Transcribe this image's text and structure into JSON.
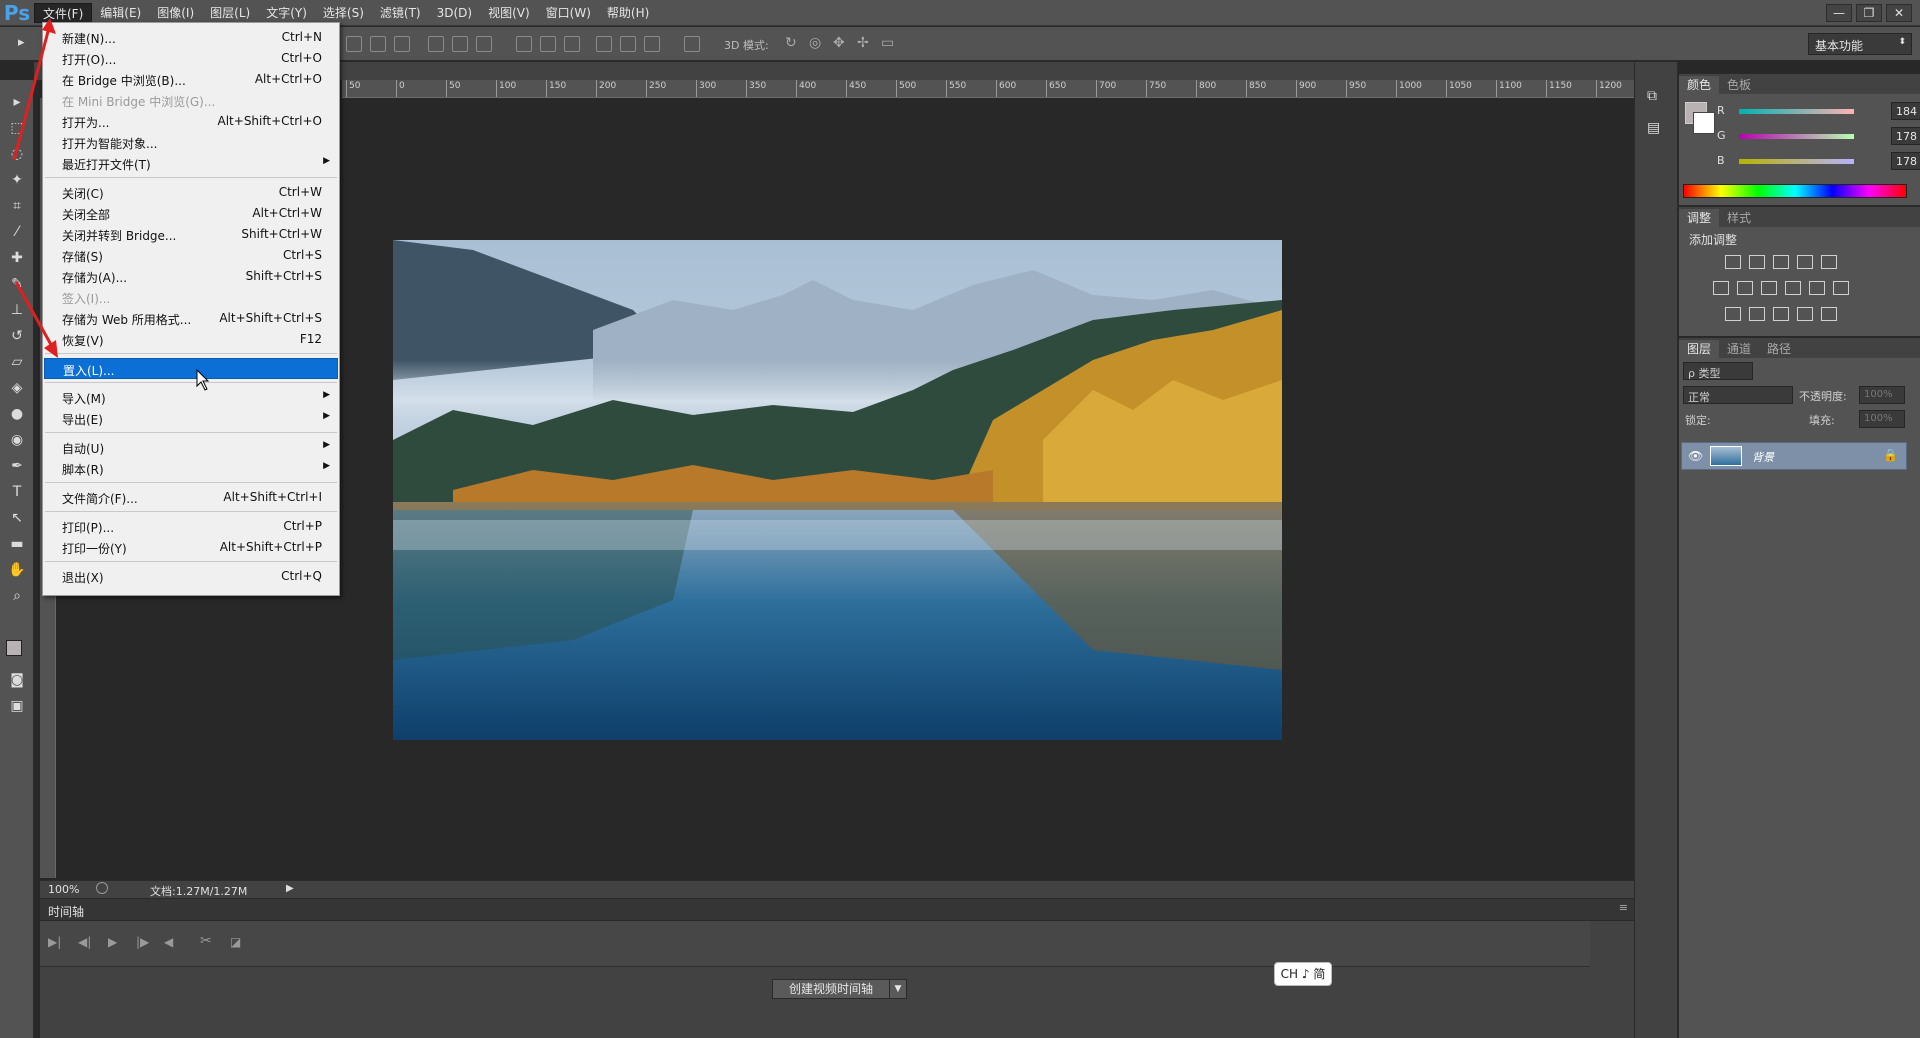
{
  "app": {
    "logo": "Ps"
  },
  "menubar": {
    "items": [
      "文件(F)",
      "编辑(E)",
      "图像(I)",
      "图层(L)",
      "文字(Y)",
      "选择(S)",
      "滤镜(T)",
      "3D(D)",
      "视图(V)",
      "窗口(W)",
      "帮助(H)"
    ],
    "active": 0
  },
  "window_controls": {
    "minimize": "—",
    "restore": "❐",
    "close": "✕"
  },
  "options": {
    "mode_3d_label": "3D 模式:",
    "workspace": "基本功能"
  },
  "ruler": {
    "ticks": [
      "50",
      "0",
      "50",
      "100",
      "150",
      "200",
      "250",
      "300",
      "350",
      "400",
      "450",
      "500",
      "550",
      "600",
      "650",
      "700",
      "750",
      "800",
      "850",
      "900",
      "950",
      "1000",
      "1050",
      "1100",
      "1150",
      "1200"
    ]
  },
  "status": {
    "zoom": "100%",
    "doc": "文档:1.27M/1.27M"
  },
  "timeline": {
    "tab": "时间轴",
    "create_button": "创建视频时间轴",
    "ime": "CH ♪ 简"
  },
  "color_panel": {
    "tabs": [
      "颜色",
      "色板"
    ],
    "channels": [
      {
        "label": "R",
        "value": "184",
        "gradient": "linear-gradient(to right,#00b2b2,#ffb2b2)"
      },
      {
        "label": "G",
        "value": "178",
        "gradient": "linear-gradient(to right,#b800b2,#b8ffb2)"
      },
      {
        "label": "B",
        "value": "178",
        "gradient": "linear-gradient(to right,#b8b200,#b8b2ff)"
      }
    ],
    "foreground": "#b8b2b2"
  },
  "adjust_panel": {
    "tabs": [
      "调整",
      "样式"
    ],
    "title": "添加调整"
  },
  "layers_panel": {
    "tabs": [
      "图层",
      "通道",
      "路径"
    ],
    "filter": "ρ 类型",
    "blend": "正常",
    "opacity_label": "不透明度:",
    "opacity": "100%",
    "lock_label": "锁定:",
    "fill_label": "填充:",
    "fill": "100%",
    "layer_name": "背景"
  },
  "file_menu": {
    "items": [
      {
        "label": "新建(N)...",
        "shortcut": "Ctrl+N"
      },
      {
        "label": "打开(O)...",
        "shortcut": "Ctrl+O"
      },
      {
        "label": "在 Bridge 中浏览(B)...",
        "shortcut": "Alt+Ctrl+O"
      },
      {
        "label": "在 Mini Bridge 中浏览(G)...",
        "shortcut": ""
      },
      {
        "label": "打开为...",
        "shortcut": "Alt+Shift+Ctrl+O"
      },
      {
        "label": "打开为智能对象...",
        "shortcut": ""
      },
      {
        "label": "最近打开文件(T)",
        "shortcut": ""
      },
      {
        "label": "关闭(C)",
        "shortcut": "Ctrl+W"
      },
      {
        "label": "关闭全部",
        "shortcut": "Alt+Ctrl+W"
      },
      {
        "label": "关闭并转到 Bridge...",
        "shortcut": "Shift+Ctrl+W"
      },
      {
        "label": "存储(S)",
        "shortcut": "Ctrl+S"
      },
      {
        "label": "存储为(A)...",
        "shortcut": "Shift+Ctrl+S"
      },
      {
        "label": "签入(I)...",
        "shortcut": ""
      },
      {
        "label": "存储为 Web 所用格式...",
        "shortcut": "Alt+Shift+Ctrl+S"
      },
      {
        "label": "恢复(V)",
        "shortcut": "F12"
      },
      {
        "label": "置入(L)...",
        "shortcut": ""
      },
      {
        "label": "导入(M)",
        "shortcut": ""
      },
      {
        "label": "导出(E)",
        "shortcut": ""
      },
      {
        "label": "自动(U)",
        "shortcut": ""
      },
      {
        "label": "脚本(R)",
        "shortcut": ""
      },
      {
        "label": "文件简介(F)...",
        "shortcut": "Alt+Shift+Ctrl+I"
      },
      {
        "label": "打印(P)...",
        "shortcut": "Ctrl+P"
      },
      {
        "label": "打印一份(Y)",
        "shortcut": "Alt+Shift+Ctrl+P"
      },
      {
        "label": "退出(X)",
        "shortcut": "Ctrl+Q"
      }
    ]
  },
  "colors": {
    "highlight": "#0b6fd6",
    "annotation_arrow": "#e02020"
  }
}
